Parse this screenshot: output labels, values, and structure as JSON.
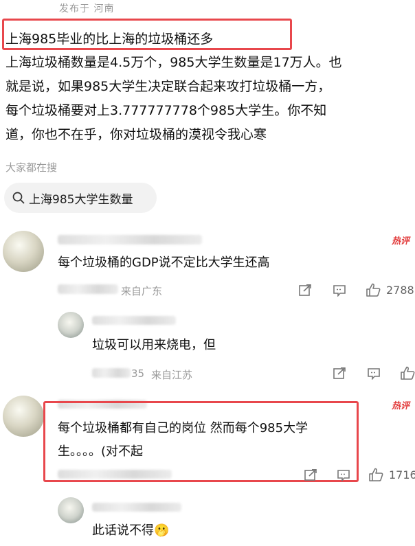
{
  "post": {
    "published_label": "发布于 河南",
    "title": "上海985毕业的比上海的垃圾桶还多",
    "body_lines": [
      "上海垃圾桶数量是4.5万个，985大学生数量是17万人。也",
      "就是说，如果985大学生决定联合起来攻打垃圾桶一方，",
      "每个垃圾桶要对上3.777777778个985大学生。你不知",
      "道，你也不在乎，你对垃圾桶的漠视令我心寒"
    ]
  },
  "search": {
    "heading": "大家都在搜",
    "chip_label": "上海985大学生数量",
    "icon": "search-icon"
  },
  "comments": [
    {
      "badge": "热评",
      "text_lines": [
        "每个垃圾桶的GDP说不定比大学生还高"
      ],
      "location": "来自广东",
      "likes": "2788"
    },
    {
      "text_lines": [
        "垃圾可以用来烧电，但"
      ],
      "location_suffix": "35",
      "location": "来自江苏"
    },
    {
      "badge": "热评",
      "text_lines": [
        "每个垃圾桶都有自己的岗位 然而每个985大学",
        "生。。。。(对不起"
      ],
      "likes": "1716"
    },
    {
      "text_lines": [
        "此话说不得"
      ],
      "emoji": "🫢"
    }
  ],
  "colors": {
    "highlight_border": "#e8474c",
    "hot_badge": "#e23b3b",
    "meta_gray": "#999999"
  }
}
